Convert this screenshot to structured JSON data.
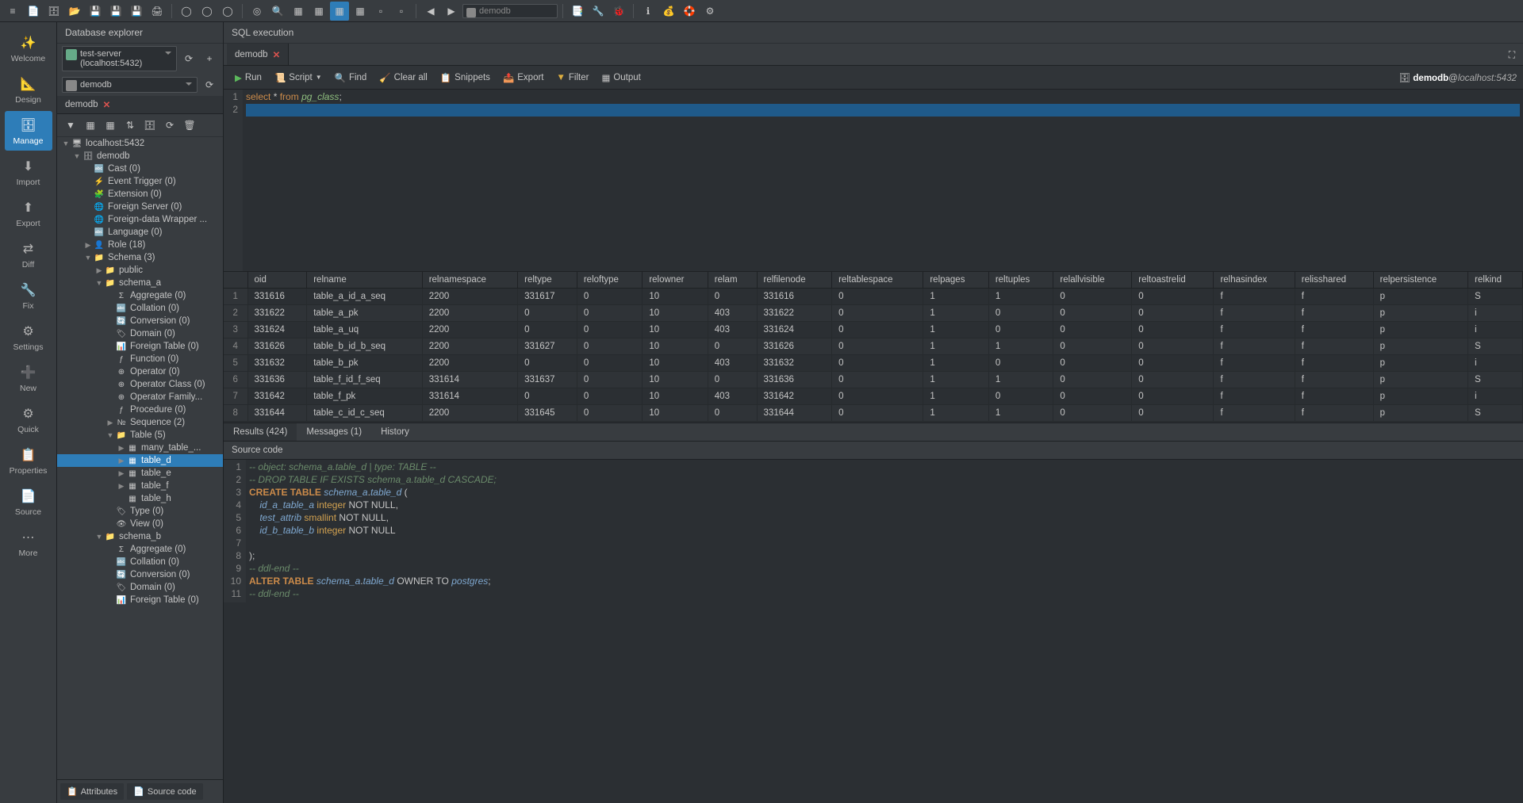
{
  "side_nav": {
    "welcome": "Welcome",
    "design": "Design",
    "manage": "Manage",
    "import": "Import",
    "export": "Export",
    "diff": "Diff",
    "fix": "Fix",
    "settings": "Settings",
    "new": "New",
    "quick": "Quick",
    "properties": "Properties",
    "source": "Source",
    "more": "More"
  },
  "top_combo": "demodb",
  "explorer": {
    "title": "Database explorer",
    "server": "test-server (localhost:5432)",
    "db": "demodb",
    "tab": "demodb",
    "footer": {
      "attributes": "Attributes",
      "source": "Source code"
    }
  },
  "tree": {
    "root": "localhost:5432",
    "db": "demodb",
    "cast": "Cast (0)",
    "event_trigger": "Event Trigger (0)",
    "extension": "Extension (0)",
    "foreign_server": "Foreign Server (0)",
    "fdw": "Foreign-data Wrapper ...",
    "language": "Language (0)",
    "role": "Role (18)",
    "schema": "Schema (3)",
    "public": "public",
    "schema_a": "schema_a",
    "aggregate": "Aggregate (0)",
    "collation": "Collation (0)",
    "conversion": "Conversion (0)",
    "domain": "Domain (0)",
    "foreign_table": "Foreign Table (0)",
    "function": "Function (0)",
    "operator": "Operator (0)",
    "operator_class": "Operator Class (0)",
    "operator_family": "Operator Family...",
    "procedure": "Procedure (0)",
    "sequence": "Sequence (2)",
    "table": "Table (5)",
    "many_table": "many_table_...",
    "table_d": "table_d",
    "table_e": "table_e",
    "table_f": "table_f",
    "table_h": "table_h",
    "type": "Type (0)",
    "view": "View (0)",
    "schema_b": "schema_b",
    "b_aggregate": "Aggregate (0)",
    "b_collation": "Collation (0)",
    "b_conversion": "Conversion (0)",
    "b_domain": "Domain (0)",
    "b_foreign_table": "Foreign Table (0)"
  },
  "sql": {
    "title": "SQL execution",
    "tab": "demodb",
    "toolbar": {
      "run": "Run",
      "script": "Script",
      "find": "Find",
      "clear": "Clear all",
      "snippets": "Snippets",
      "export": "Export",
      "filter": "Filter",
      "output": "Output"
    },
    "conn": {
      "db": "demodb",
      "host": "localhost:5432"
    },
    "code": {
      "select": "select",
      "star": "*",
      "from": "from",
      "ident": "pg_class",
      "semi": ";"
    },
    "results_tabs": {
      "results": "Results (424)",
      "messages": "Messages (1)",
      "history": "History"
    }
  },
  "grid": {
    "headers": [
      "oid",
      "relname",
      "relnamespace",
      "reltype",
      "reloftype",
      "relowner",
      "relam",
      "relfilenode",
      "reltablespace",
      "relpages",
      "reltuples",
      "relallvisible",
      "reltoastrelid",
      "relhasindex",
      "relisshared",
      "relpersistence",
      "relkind"
    ],
    "rows": [
      [
        "331616",
        "table_a_id_a_seq",
        "2200",
        "331617",
        "0",
        "10",
        "0",
        "331616",
        "0",
        "1",
        "1",
        "0",
        "0",
        "f",
        "f",
        "p",
        "S"
      ],
      [
        "331622",
        "table_a_pk",
        "2200",
        "0",
        "0",
        "10",
        "403",
        "331622",
        "0",
        "1",
        "0",
        "0",
        "0",
        "f",
        "f",
        "p",
        "i"
      ],
      [
        "331624",
        "table_a_uq",
        "2200",
        "0",
        "0",
        "10",
        "403",
        "331624",
        "0",
        "1",
        "0",
        "0",
        "0",
        "f",
        "f",
        "p",
        "i"
      ],
      [
        "331626",
        "table_b_id_b_seq",
        "2200",
        "331627",
        "0",
        "10",
        "0",
        "331626",
        "0",
        "1",
        "1",
        "0",
        "0",
        "f",
        "f",
        "p",
        "S"
      ],
      [
        "331632",
        "table_b_pk",
        "2200",
        "0",
        "0",
        "10",
        "403",
        "331632",
        "0",
        "1",
        "0",
        "0",
        "0",
        "f",
        "f",
        "p",
        "i"
      ],
      [
        "331636",
        "table_f_id_f_seq",
        "331614",
        "331637",
        "0",
        "10",
        "0",
        "331636",
        "0",
        "1",
        "1",
        "0",
        "0",
        "f",
        "f",
        "p",
        "S"
      ],
      [
        "331642",
        "table_f_pk",
        "331614",
        "0",
        "0",
        "10",
        "403",
        "331642",
        "0",
        "1",
        "0",
        "0",
        "0",
        "f",
        "f",
        "p",
        "i"
      ],
      [
        "331644",
        "table_c_id_c_seq",
        "2200",
        "331645",
        "0",
        "10",
        "0",
        "331644",
        "0",
        "1",
        "1",
        "0",
        "0",
        "f",
        "f",
        "p",
        "S"
      ]
    ]
  },
  "source": {
    "title": "Source code",
    "lines": [
      {
        "t": "cmt",
        "s": "-- object: schema_a.table_d | type: TABLE --"
      },
      {
        "t": "cmt",
        "s": "-- DROP TABLE IF EXISTS schema_a.table_d CASCADE;"
      },
      {
        "t": "ddl_create",
        "kw": "CREATE TABLE",
        "id": "schema_a",
        "id2": "table_d",
        "end": " ("
      },
      {
        "t": "col",
        "name": "id_a_table_a",
        "type": "integer",
        "rest": "NOT NULL",
        "comma": ","
      },
      {
        "t": "col",
        "name": "test_attrib",
        "type": "smallint",
        "rest": "NOT NULL",
        "comma": ","
      },
      {
        "t": "col",
        "name": "id_b_table_b",
        "type": "integer",
        "rest": "NOT NULL",
        "comma": ""
      },
      {
        "t": "blank",
        "s": ""
      },
      {
        "t": "plain",
        "s": ");"
      },
      {
        "t": "cmt",
        "s": "-- ddl-end --"
      },
      {
        "t": "alter",
        "kw": "ALTER TABLE",
        "id": "schema_a",
        "id2": "table_d",
        "rest": " OWNER TO ",
        "own": "postgres",
        "semi": ";"
      },
      {
        "t": "cmt",
        "s": "-- ddl-end --"
      },
      {
        "t": "blank",
        "s": ""
      },
      {
        "t": "blank",
        "s": ""
      }
    ]
  }
}
